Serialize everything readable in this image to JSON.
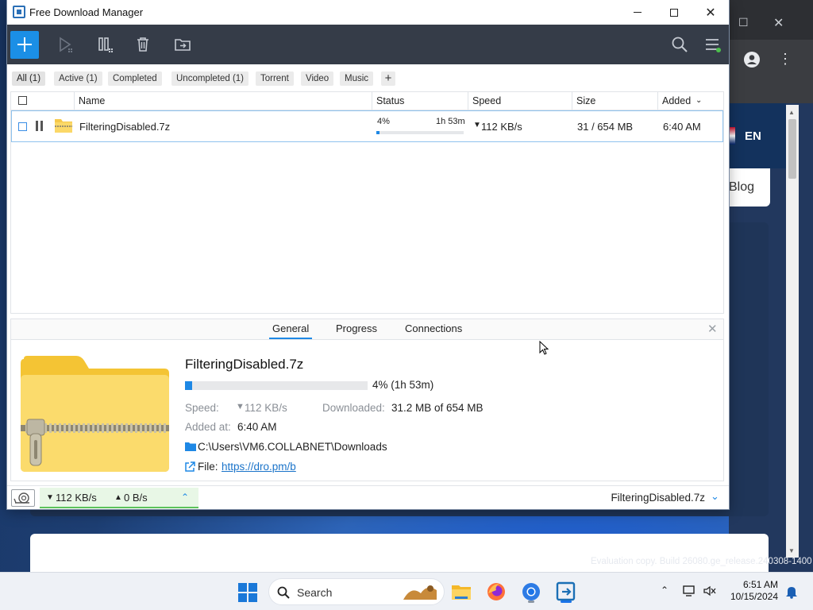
{
  "window": {
    "title": "Free Download Manager"
  },
  "filters": [
    {
      "label": "All (1)",
      "active": true
    },
    {
      "label": "Active (1)"
    },
    {
      "label": "Completed"
    },
    {
      "label": "Uncompleted (1)"
    },
    {
      "label": "Torrent"
    },
    {
      "label": "Video"
    },
    {
      "label": "Music"
    }
  ],
  "table": {
    "headers": {
      "name": "Name",
      "status": "Status",
      "speed": "Speed",
      "size": "Size",
      "added": "Added"
    },
    "rows": [
      {
        "name": "FilteringDisabled.7z",
        "progress_text": "4%",
        "progress_fraction": 0.04,
        "eta": "1h 53m",
        "speed": "112 KB/s",
        "size": "31 / 654 MB",
        "added": "6:40 AM"
      }
    ]
  },
  "details": {
    "tabs": [
      "General",
      "Progress",
      "Connections"
    ],
    "active_tab": "General",
    "file_name": "FilteringDisabled.7z",
    "progress_fraction": 0.04,
    "progress_text": "4% (1h 53m)",
    "speed_label": "Speed:",
    "speed_value": "112 KB/s",
    "downloaded_label": "Downloaded:",
    "downloaded_value": "31.2 MB of 654 MB",
    "added_label": "Added at:",
    "added_value": "6:40 AM",
    "path": "C:\\Users\\VM6.COLLABNET\\Downloads",
    "file_label": "File:",
    "file_link": "https://dro.pm/b"
  },
  "statusbar": {
    "down_speed": "112 KB/s",
    "up_speed": "0 B/s",
    "current_file": "FilteringDisabled.7z"
  },
  "background": {
    "language": "EN",
    "blog": "Blog",
    "watermark": "Evaluation copy. Build 26080.ge_release.240308-1400"
  },
  "taskbar": {
    "search_placeholder": "Search",
    "time": "6:51 AM",
    "date": "10/15/2024"
  },
  "colors": {
    "accent": "#1e88e5",
    "toolbar": "#353c48",
    "speed_ok": "#5cc35c"
  }
}
